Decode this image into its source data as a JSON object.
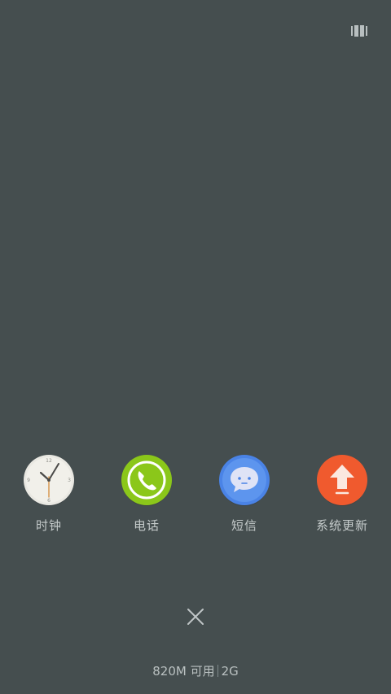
{
  "toolbar": {
    "view_toggle_icon": "grid-view-icon"
  },
  "recent_apps": [
    {
      "label": "时钟",
      "icon": "clock-icon"
    },
    {
      "label": "电话",
      "icon": "phone-icon"
    },
    {
      "label": "短信",
      "icon": "message-icon"
    },
    {
      "label": "系统更新",
      "icon": "update-icon"
    }
  ],
  "close": {
    "icon": "close-icon"
  },
  "memory": {
    "available": "820M 可用",
    "total": "2G"
  },
  "colors": {
    "background": "#454e4f",
    "phone": "#8bc71a",
    "message": "#4a83e6",
    "update": "#f05a2e"
  }
}
